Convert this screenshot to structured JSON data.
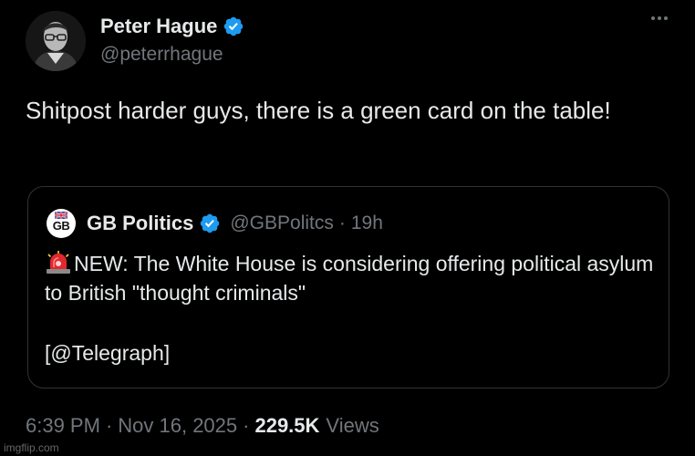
{
  "author": {
    "display_name": "Peter Hague",
    "handle": "@peterrhague",
    "verified": true
  },
  "tweet": {
    "text": "Shitpost harder guys, there is a green card on the table!",
    "time": "6:39 PM",
    "date": "Nov 16, 2025",
    "views_count": "229.5K",
    "views_label": "Views"
  },
  "quoted": {
    "logo_text": "GB",
    "display_name": "GB Politics",
    "handle": "@GBPolitcs",
    "separator": "·",
    "age": "19h",
    "body": "NEW: The White House is considering offering political asylum to British \"thought criminals\"",
    "source": "[@Telegraph]"
  },
  "meta": {
    "separator": "·"
  },
  "watermark": "imgflip.com",
  "icons": {
    "verified": "verified-badge-icon",
    "more": "more-options-icon",
    "siren": "siren-emoji-icon"
  },
  "colors": {
    "background": "#000000",
    "text": "#e7e9ea",
    "muted": "#71767b",
    "verified": "#1d9bf0",
    "border": "#2f3336"
  }
}
